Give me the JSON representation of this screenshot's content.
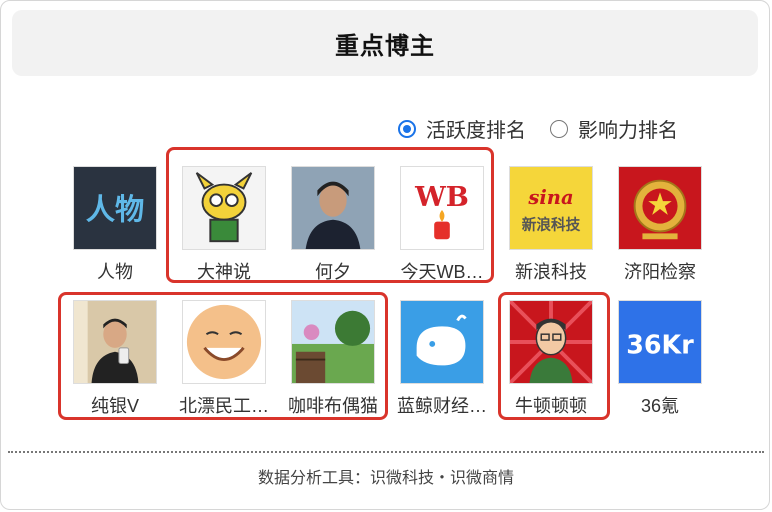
{
  "header": {
    "title": "重点博主"
  },
  "ranking_options": [
    {
      "label": "活跃度排名",
      "checked": true
    },
    {
      "label": "影响力排名",
      "checked": false
    }
  ],
  "bloggers": [
    {
      "name": "人物",
      "avatar_text": "人物"
    },
    {
      "name": "大神说"
    },
    {
      "name": "何夕"
    },
    {
      "name": "今天WB…",
      "avatar_text": "WB"
    },
    {
      "name": "新浪科技",
      "avatar_text_top": "sina",
      "avatar_text_bottom": "新浪科技"
    },
    {
      "name": "济阳检察"
    },
    {
      "name": "纯银V"
    },
    {
      "name": "北漂民工…"
    },
    {
      "name": "咖啡布偶猫"
    },
    {
      "name": "蓝鲸财经…"
    },
    {
      "name": "牛顿顿顿"
    },
    {
      "name": "36氪",
      "avatar_text": "36Kr"
    }
  ],
  "footer": {
    "text": "数据分析工具：识微科技・识微商情"
  },
  "colors": {
    "accent": "#1a73e8",
    "highlight": "#d9342b"
  }
}
